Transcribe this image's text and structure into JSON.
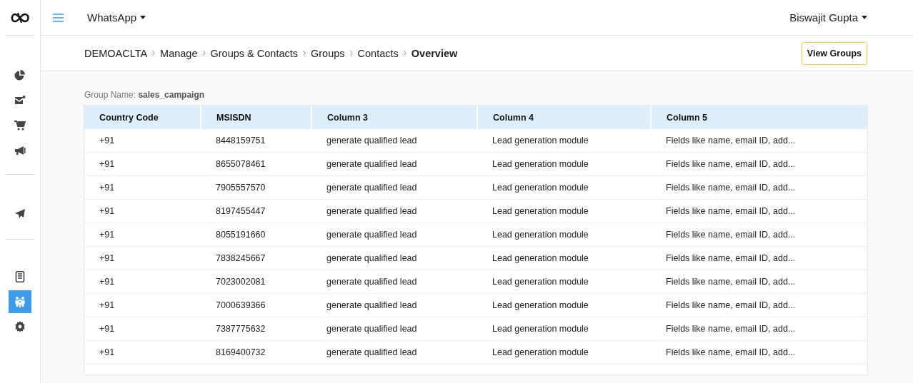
{
  "sidebar": {
    "groups": [
      {
        "items": [
          {
            "selected": false
          },
          {
            "selected": false
          },
          {
            "selected": false
          },
          {
            "selected": false
          }
        ]
      },
      {
        "items": [
          {
            "selected": false
          }
        ]
      },
      {
        "items": [
          {
            "selected": false
          },
          {
            "selected": true
          },
          {
            "selected": false
          }
        ]
      }
    ]
  },
  "topbar": {
    "app_menu": "WhatsApp",
    "user_menu": "Biswajit Gupta"
  },
  "breadcrumb": [
    {
      "label": "DEMOACLTA",
      "current": false
    },
    {
      "label": "Manage",
      "current": false
    },
    {
      "label": "Groups & Contacts",
      "current": false
    },
    {
      "label": "Groups",
      "current": false
    },
    {
      "label": "Contacts",
      "current": false
    },
    {
      "label": "Overview",
      "current": true
    }
  ],
  "view_groups_button": "View Groups",
  "group_name": {
    "label": "Group Name:",
    "value": "sales_campaign"
  },
  "table": {
    "columns": [
      "Country Code",
      "MSISDN",
      "Column 3",
      "Column 4",
      "Column 5"
    ],
    "rows": [
      [
        "+91",
        "8448159751",
        "generate qualified lead",
        "Lead generation module",
        "Fields like name, email ID, add..."
      ],
      [
        "+91",
        "8655078461",
        "generate qualified lead",
        "Lead generation module",
        "Fields like name, email ID, add..."
      ],
      [
        "+91",
        "7905557570",
        "generate qualified lead",
        "Lead generation module",
        "Fields like name, email ID, add..."
      ],
      [
        "+91",
        "8197455447",
        "generate qualified lead",
        "Lead generation module",
        "Fields like name, email ID, add..."
      ],
      [
        "+91",
        "8055191660",
        "generate qualified lead",
        "Lead generation module",
        "Fields like name, email ID, add..."
      ],
      [
        "+91",
        "7838245667",
        "generate qualified lead",
        "Lead generation module",
        "Fields like name, email ID, add..."
      ],
      [
        "+91",
        "7023002081",
        "generate qualified lead",
        "Lead generation module",
        "Fields like name, email ID, add..."
      ],
      [
        "+91",
        "7000639366",
        "generate qualified lead",
        "Lead generation module",
        "Fields like name, email ID, add..."
      ],
      [
        "+91",
        "7387775632",
        "generate qualified lead",
        "Lead generation module",
        "Fields like name, email ID, add..."
      ],
      [
        "+91",
        "8169400732",
        "generate qualified lead",
        "Lead generation module",
        "Fields like name, email ID, add..."
      ]
    ]
  }
}
